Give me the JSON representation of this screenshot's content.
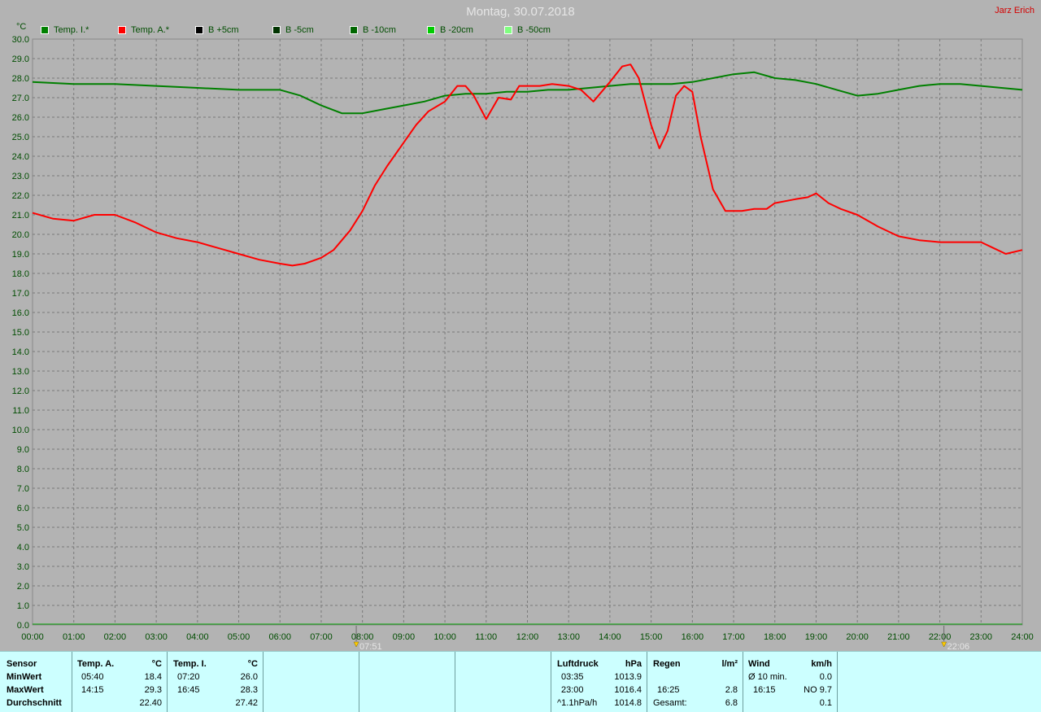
{
  "header": {
    "title": "Montag, 30.07.2018",
    "author": "Jarz Erich"
  },
  "legend": [
    {
      "label": "Temp. I.*",
      "color": "#008000"
    },
    {
      "label": "Temp. A.*",
      "color": "#ff0000"
    },
    {
      "label": "B +5cm",
      "color": "#000000"
    },
    {
      "label": "B -5cm",
      "color": "#003300"
    },
    {
      "label": "B -10cm",
      "color": "#006600"
    },
    {
      "label": "B -20cm",
      "color": "#00cc00"
    },
    {
      "label": "B -50cm",
      "color": "#80ff80"
    }
  ],
  "chart_data": {
    "type": "line",
    "ylabel": "°C",
    "ylim": [
      0,
      30
    ],
    "y_ticks": [
      "0.0",
      "1.0",
      "2.0",
      "3.0",
      "4.0",
      "5.0",
      "6.0",
      "7.0",
      "8.0",
      "9.0",
      "10.0",
      "11.0",
      "12.0",
      "13.0",
      "14.0",
      "15.0",
      "16.0",
      "17.0",
      "18.0",
      "19.0",
      "20.0",
      "21.0",
      "22.0",
      "23.0",
      "24.0",
      "25.0",
      "26.0",
      "27.0",
      "28.0",
      "29.0",
      "30.0"
    ],
    "x_ticks": [
      "00:00",
      "01:00",
      "02:00",
      "03:00",
      "04:00",
      "05:00",
      "06:00",
      "07:00",
      "08:00",
      "09:00",
      "10:00",
      "11:00",
      "12:00",
      "13:00",
      "14:00",
      "15:00",
      "16:00",
      "17:00",
      "18:00",
      "19:00",
      "20:00",
      "21:00",
      "22:00",
      "23:00",
      "24:00"
    ],
    "xlim_hours": [
      0,
      24
    ],
    "grid": true,
    "markers": [
      {
        "time": "07:51",
        "hour": 7.85,
        "kind": "sunrise"
      },
      {
        "time": "22:06",
        "hour": 22.1,
        "kind": "sunset"
      }
    ],
    "series": [
      {
        "name": "Temp. I.*",
        "color": "#008000",
        "x": [
          0,
          1,
          2,
          3,
          4,
          5,
          6,
          6.5,
          7,
          7.5,
          8,
          8.5,
          9,
          9.5,
          10,
          10.5,
          11,
          11.5,
          12,
          12.5,
          13,
          13.5,
          14,
          14.5,
          15,
          15.5,
          16,
          16.5,
          17,
          17.5,
          18,
          18.5,
          19,
          19.5,
          20,
          20.5,
          21,
          21.5,
          22,
          22.5,
          23,
          23.5,
          24
        ],
        "y": [
          27.8,
          27.7,
          27.7,
          27.6,
          27.5,
          27.4,
          27.4,
          27.1,
          26.6,
          26.2,
          26.2,
          26.4,
          26.6,
          26.8,
          27.1,
          27.2,
          27.2,
          27.3,
          27.3,
          27.4,
          27.4,
          27.5,
          27.6,
          27.7,
          27.7,
          27.7,
          27.8,
          28.0,
          28.2,
          28.3,
          28.0,
          27.9,
          27.7,
          27.4,
          27.1,
          27.2,
          27.4,
          27.6,
          27.7,
          27.7,
          27.6,
          27.5,
          27.4
        ]
      },
      {
        "name": "Temp. A.*",
        "color": "#ff0000",
        "x": [
          0,
          0.5,
          1,
          1.5,
          2,
          2.5,
          3,
          3.5,
          4,
          4.5,
          5,
          5.5,
          6,
          6.3,
          6.6,
          7,
          7.3,
          7.7,
          8,
          8.3,
          8.6,
          9,
          9.3,
          9.6,
          10,
          10.3,
          10.5,
          10.7,
          11,
          11.3,
          11.6,
          11.8,
          12,
          12.3,
          12.6,
          13,
          13.3,
          13.6,
          14,
          14.3,
          14.5,
          14.7,
          15,
          15.2,
          15.4,
          15.6,
          15.8,
          16,
          16.2,
          16.5,
          16.8,
          17.2,
          17.5,
          17.8,
          18,
          18.5,
          18.8,
          19,
          19.3,
          19.6,
          20,
          20.5,
          21,
          21.5,
          22,
          22.5,
          23,
          23.3,
          23.6,
          24
        ],
        "y": [
          21.1,
          20.8,
          20.7,
          21.0,
          21.0,
          20.6,
          20.1,
          19.8,
          19.6,
          19.3,
          19.0,
          18.7,
          18.5,
          18.4,
          18.5,
          18.8,
          19.2,
          20.2,
          21.2,
          22.5,
          23.5,
          24.7,
          25.6,
          26.3,
          26.8,
          27.6,
          27.6,
          27.1,
          25.9,
          27.0,
          26.9,
          27.6,
          27.6,
          27.6,
          27.7,
          27.6,
          27.4,
          26.8,
          27.8,
          28.6,
          28.7,
          28.0,
          25.6,
          24.4,
          25.3,
          27.1,
          27.6,
          27.3,
          25.0,
          22.3,
          21.2,
          21.2,
          21.3,
          21.3,
          21.6,
          21.8,
          21.9,
          22.1,
          21.6,
          21.3,
          21.0,
          20.4,
          19.9,
          19.7,
          19.6,
          19.6,
          19.6,
          19.3,
          19.0,
          19.2
        ]
      }
    ]
  },
  "stats": {
    "sensor": {
      "header": "Sensor",
      "min": "MinWert",
      "max": "MaxWert",
      "avg": "Durchschnitt"
    },
    "temp_a": {
      "header": "Temp. A.",
      "unit": "°C",
      "min_time": "05:40",
      "min_val": "18.4",
      "max_time": "14:15",
      "max_val": "29.3",
      "avg_val": "22.40"
    },
    "temp_i": {
      "header": "Temp. I.",
      "unit": "°C",
      "min_time": "07:20",
      "min_val": "26.0",
      "max_time": "16:45",
      "max_val": "28.3",
      "avg_val": "27.42"
    },
    "pressure": {
      "header": "Luftdruck",
      "unit": "hPa",
      "min_time": "03:35",
      "min_val": "1013.9",
      "max_time": "23:00",
      "max_val": "1016.4",
      "trend": "^1.1hPa/h",
      "trend_val": "1014.8"
    },
    "rain": {
      "header": "Regen",
      "unit": "l/m²",
      "max_time": "16:25",
      "max_val": "2.8",
      "total_label": "Gesamt:",
      "total_val": "6.8"
    },
    "wind": {
      "header": "Wind",
      "unit": "km/h",
      "avg_label": "Ø 10 min.",
      "avg_val": "0.0",
      "max_time": "16:15",
      "max_val": "NO 9.7",
      "last_val": "0.1"
    }
  }
}
